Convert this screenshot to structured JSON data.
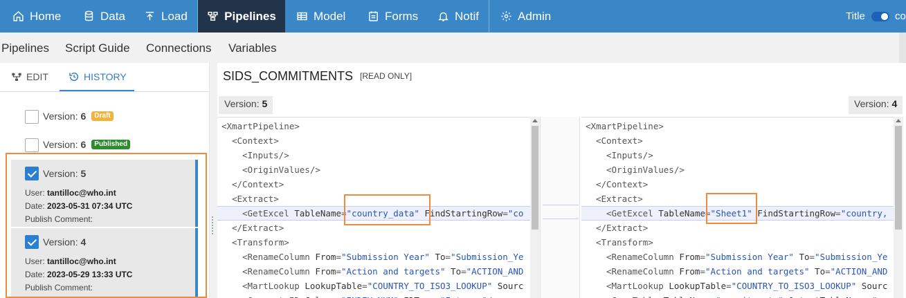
{
  "nav": {
    "items": [
      {
        "label": "Home",
        "icon": "home-icon"
      },
      {
        "label": "Data",
        "icon": "database-icon"
      },
      {
        "label": "Load",
        "icon": "upload-icon"
      },
      {
        "label": "Pipelines",
        "icon": "pipeline-icon",
        "active": true
      },
      {
        "label": "Model",
        "icon": "table-icon"
      },
      {
        "label": "Forms",
        "icon": "form-icon"
      },
      {
        "label": "Notif",
        "icon": "bell-icon"
      },
      {
        "label": "Admin",
        "icon": "gear-icon"
      }
    ],
    "title_label": "Title",
    "toggle_text": "co"
  },
  "subnav": {
    "items": [
      "Pipelines",
      "Script Guide",
      "Connections",
      "Variables"
    ]
  },
  "left": {
    "tabs": [
      {
        "label": "EDIT",
        "icon": "edit-tree-icon"
      },
      {
        "label": "HISTORY",
        "icon": "history-icon",
        "active": true
      }
    ],
    "version_prefix": "Version:",
    "versions": [
      {
        "number": "6",
        "badge": "Draft",
        "checked": false
      },
      {
        "number": "6",
        "badge": "Published",
        "checked": false
      },
      {
        "number": "5",
        "checked": true,
        "user_label": "User:",
        "user": "tantilloc@who.int",
        "date_label": "Date:",
        "date": "2023-05-31 07:34 UTC",
        "comment_label": "Publish Comment:"
      },
      {
        "number": "4",
        "checked": true,
        "user_label": "User:",
        "user": "tantilloc@who.int",
        "date_label": "Date:",
        "date": "2023-05-29 13:33 UTC",
        "comment_label": "Publish Comment:"
      }
    ]
  },
  "main": {
    "title": "SIDS_COMMITMENTS",
    "read_only": "[READ ONLY]",
    "left_version_label": "Version:",
    "left_version": "5",
    "right_version_label": "Version:",
    "right_version": "4"
  },
  "code": {
    "left": [
      {
        "indent": 0,
        "parts": [
          [
            "t",
            "<XmartPipeline>"
          ]
        ]
      },
      {
        "indent": 1,
        "parts": [
          [
            "t",
            "<Context>"
          ]
        ]
      },
      {
        "indent": 2,
        "parts": [
          [
            "t",
            "<Inputs/>"
          ]
        ]
      },
      {
        "indent": 2,
        "parts": [
          [
            "t",
            "<OriginValues/>"
          ]
        ]
      },
      {
        "indent": 1,
        "parts": [
          [
            "t",
            "</Context>"
          ]
        ]
      },
      {
        "indent": 1,
        "parts": [
          [
            "t",
            "<Extract>"
          ]
        ]
      },
      {
        "indent": 2,
        "parts": [
          [
            "t",
            "<GetExcel "
          ],
          [
            "a",
            "TableName"
          ],
          [
            "t",
            "="
          ],
          [
            "s",
            "\"country_data\""
          ],
          [
            "a",
            " FindStartingRow"
          ],
          [
            "t",
            "="
          ],
          [
            "s",
            "\"co"
          ]
        ],
        "diff": true
      },
      {
        "indent": 1,
        "parts": [
          [
            "t",
            "</Extract>"
          ]
        ]
      },
      {
        "indent": 1,
        "parts": [
          [
            "t",
            "<Transform>"
          ]
        ]
      },
      {
        "indent": 2,
        "parts": [
          [
            "t",
            "<RenameColumn "
          ],
          [
            "a",
            "From"
          ],
          [
            "t",
            "="
          ],
          [
            "s",
            "\"Submission Year\""
          ],
          [
            "a",
            " To"
          ],
          [
            "t",
            "="
          ],
          [
            "s",
            "\"Submission_Ye"
          ]
        ]
      },
      {
        "indent": 2,
        "parts": [
          [
            "t",
            "<RenameColumn "
          ],
          [
            "a",
            "From"
          ],
          [
            "t",
            "="
          ],
          [
            "s",
            "\"Action and targets\""
          ],
          [
            "a",
            " To"
          ],
          [
            "t",
            "="
          ],
          [
            "s",
            "\"ACTION_AND"
          ]
        ]
      },
      {
        "indent": 2,
        "parts": [
          [
            "t",
            "<MartLookup "
          ],
          [
            "a",
            "LookupTable"
          ],
          [
            "t",
            "="
          ],
          [
            "s",
            "\"COUNTRY_TO_ISO3_LOOKUP\""
          ],
          [
            "a",
            " Sourc"
          ]
        ]
      },
      {
        "indent": 2,
        "parts": [
          [
            "t",
            "<GenerateID "
          ],
          [
            "a",
            "Column"
          ],
          [
            "t",
            "="
          ],
          [
            "s",
            "\"INDEX_NUM\""
          ],
          [
            "a",
            " IDType"
          ],
          [
            "t",
            "="
          ],
          [
            "s",
            "\"Integer\""
          ],
          [
            "t",
            "/>"
          ]
        ]
      }
    ],
    "right": [
      {
        "indent": 0,
        "parts": [
          [
            "t",
            "<XmartPipeline>"
          ]
        ]
      },
      {
        "indent": 1,
        "parts": [
          [
            "t",
            "<Context>"
          ]
        ]
      },
      {
        "indent": 2,
        "parts": [
          [
            "t",
            "<Inputs/>"
          ]
        ]
      },
      {
        "indent": 2,
        "parts": [
          [
            "t",
            "<OriginValues/>"
          ]
        ]
      },
      {
        "indent": 1,
        "parts": [
          [
            "t",
            "</Context>"
          ]
        ]
      },
      {
        "indent": 1,
        "parts": [
          [
            "t",
            "<Extract>"
          ]
        ]
      },
      {
        "indent": 2,
        "parts": [
          [
            "t",
            "<GetExcel "
          ],
          [
            "a",
            "TableName"
          ],
          [
            "t",
            "="
          ],
          [
            "s",
            "\"Sheet1\""
          ],
          [
            "a",
            " FindStartingRow"
          ],
          [
            "t",
            "="
          ],
          [
            "s",
            "\"country,"
          ]
        ],
        "diff": true
      },
      {
        "indent": 1,
        "parts": [
          [
            "t",
            "</Extract>"
          ]
        ]
      },
      {
        "indent": 1,
        "parts": [
          [
            "t",
            "<Transform>"
          ]
        ]
      },
      {
        "indent": 2,
        "parts": [
          [
            "t",
            "<RenameColumn "
          ],
          [
            "a",
            "From"
          ],
          [
            "t",
            "="
          ],
          [
            "s",
            "\"Submission Year\""
          ],
          [
            "a",
            " To"
          ],
          [
            "t",
            "="
          ],
          [
            "s",
            "\"Submission_Ye"
          ]
        ]
      },
      {
        "indent": 2,
        "parts": [
          [
            "t",
            "<RenameColumn "
          ],
          [
            "a",
            "From"
          ],
          [
            "t",
            "="
          ],
          [
            "s",
            "\"Action and targets\""
          ],
          [
            "a",
            " To"
          ],
          [
            "t",
            "="
          ],
          [
            "s",
            "\"ACTION_AND"
          ]
        ]
      },
      {
        "indent": 2,
        "parts": [
          [
            "t",
            "<MartLookup "
          ],
          [
            "a",
            "LookupTable"
          ],
          [
            "t",
            "="
          ],
          [
            "s",
            "\"COUNTRY_TO_ISO3_LOOKUP\""
          ],
          [
            "a",
            " Sourc"
          ]
        ]
      },
      {
        "indent": 2,
        "parts": [
          [
            "t",
            "<CopyTable "
          ],
          [
            "a",
            "TableName"
          ],
          [
            "t",
            "="
          ],
          [
            "s",
            "\"commitments\""
          ],
          [
            "a",
            " OutputTableName"
          ],
          [
            "t",
            "="
          ],
          [
            "s",
            "\"co"
          ]
        ]
      }
    ]
  },
  "colors": {
    "nav_bg": "#3a87c8",
    "nav_active": "#22344a",
    "highlight": "#f08a3c",
    "string": "#2955b8"
  }
}
